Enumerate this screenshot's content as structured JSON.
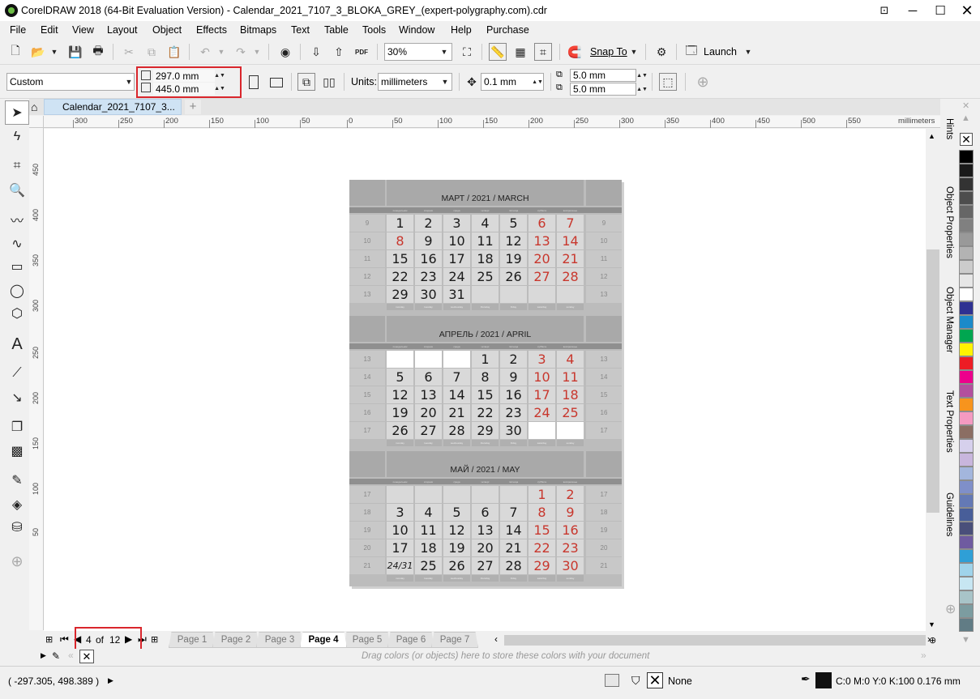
{
  "window": {
    "title": "CorelDRAW 2018 (64-Bit Evaluation Version) - Calendar_2021_7107_3_BLOKA_GREY_(expert-polygraphy.com).cdr"
  },
  "menu": [
    "File",
    "Edit",
    "View",
    "Layout",
    "Object",
    "Effects",
    "Bitmaps",
    "Text",
    "Table",
    "Tools",
    "Window",
    "Help",
    "Purchase"
  ],
  "standard_toolbar": {
    "zoom": "30%",
    "snap_to": "Snap To",
    "launch": "Launch",
    "pdf": "PDF"
  },
  "property_bar": {
    "page_preset": "Custom",
    "width": "297.0 mm",
    "height": "445.0 mm",
    "units_label": "Units:",
    "units": "millimeters",
    "nudge": "0.1 mm",
    "dup_x": "5.0 mm",
    "dup_y": "5.0 mm"
  },
  "document_tab": "Calendar_2021_7107_3...",
  "ruler_h": {
    "units": "millimeters",
    "ticks": [
      "300",
      "250",
      "200",
      "150",
      "100",
      "50",
      "0",
      "50",
      "100",
      "150",
      "200",
      "250",
      "300",
      "350",
      "400",
      "450",
      "500",
      "550"
    ]
  },
  "ruler_v": [
    "450",
    "400",
    "350",
    "300",
    "250",
    "200",
    "150",
    "100",
    "50"
  ],
  "page_nav": {
    "current": "4",
    "of": "of",
    "total": "12",
    "pages": [
      "Page 1",
      "Page 2",
      "Page 3",
      "Page 4",
      "Page 5",
      "Page 6",
      "Page 7"
    ],
    "active": "Page 4"
  },
  "palette_hint": "Drag colors (or objects) here to store these colors with your document",
  "status": {
    "coords": "( -297.305, 498.389 )",
    "fill": "None",
    "outline": "C:0 M:0 Y:0 K:100  0.176 mm"
  },
  "dockers": [
    "Hints",
    "Object Properties",
    "Object Manager",
    "Text Properties",
    "Guidelines"
  ],
  "colors": {
    "red_box": "#d9262c",
    "cal_red": "#c8372d",
    "tab_blue": "#cfe3f4"
  },
  "palette": [
    "#000000",
    "#1a1a1a",
    "#333333",
    "#4d4d4d",
    "#666666",
    "#808080",
    "#999999",
    "#b3b3b3",
    "#cccccc",
    "#e6e6e6",
    "#ffffff",
    "#2e3192",
    "#1b8ac9",
    "#00a650",
    "#fff200",
    "#ed1c24",
    "#ec008c",
    "#b34f9e",
    "#f7941d",
    "#f49ac1",
    "#8b6e63",
    "#d6d0ec",
    "#c8b6dd",
    "#a3b6dd",
    "#7f8fc9",
    "#6479b5",
    "#485e99",
    "#4a4f7a",
    "#6f5ba0",
    "#2f9fd6",
    "#9fd3ea",
    "#c7e6f2",
    "#a8c4c8",
    "#7c9ca0",
    "#617c85"
  ],
  "calendar": {
    "day_names": [
      "понедельник",
      "вторник",
      "среда",
      "четверг",
      "пятница",
      "суббота",
      "воскресенье"
    ],
    "day_names_en": [
      "monday",
      "tuesday",
      "wednesday",
      "thursday",
      "friday",
      "saturday",
      "sunday"
    ],
    "months": [
      {
        "title": "МАРТ / 2021 / MARCH",
        "weeks": [
          "9",
          "10",
          "11",
          "12",
          "13"
        ],
        "rows": [
          [
            "1",
            "2",
            "3",
            "4",
            "5",
            "6",
            "7"
          ],
          [
            "8",
            "9",
            "10",
            "11",
            "12",
            "13",
            "14"
          ],
          [
            "15",
            "16",
            "17",
            "18",
            "19",
            "20",
            "21"
          ],
          [
            "22",
            "23",
            "24",
            "25",
            "26",
            "27",
            "28"
          ],
          [
            "29",
            "30",
            "31",
            "",
            "",
            "",
            ""
          ]
        ],
        "red": [
          [
            5,
            6
          ],
          [
            0,
            5,
            6
          ],
          [
            5,
            6
          ],
          [
            5,
            6
          ],
          []
        ]
      },
      {
        "title": "АПРЕЛЬ / 2021 / APRIL",
        "weeks": [
          "13",
          "14",
          "15",
          "16",
          "17"
        ],
        "rows": [
          [
            "",
            "",
            "",
            "1",
            "2",
            "3",
            "4"
          ],
          [
            "5",
            "6",
            "7",
            "8",
            "9",
            "10",
            "11"
          ],
          [
            "12",
            "13",
            "14",
            "15",
            "16",
            "17",
            "18"
          ],
          [
            "19",
            "20",
            "21",
            "22",
            "23",
            "24",
            "25"
          ],
          [
            "26",
            "27",
            "28",
            "29",
            "30",
            "",
            ""
          ]
        ],
        "red": [
          [
            5,
            6
          ],
          [
            5,
            6
          ],
          [
            5,
            6
          ],
          [
            5,
            6
          ],
          []
        ]
      },
      {
        "title": "МАЙ / 2021 / MAY",
        "weeks": [
          "17",
          "18",
          "19",
          "20",
          "21"
        ],
        "rows": [
          [
            "",
            "",
            "",
            "",
            "",
            "1",
            "2"
          ],
          [
            "3",
            "4",
            "5",
            "6",
            "7",
            "8",
            "9"
          ],
          [
            "10",
            "11",
            "12",
            "13",
            "14",
            "15",
            "16"
          ],
          [
            "17",
            "18",
            "19",
            "20",
            "21",
            "22",
            "23"
          ],
          [
            "24/31",
            "25",
            "26",
            "27",
            "28",
            "29",
            "30"
          ]
        ],
        "red": [
          [
            5,
            6
          ],
          [
            5,
            6
          ],
          [
            5,
            6
          ],
          [
            5,
            6
          ],
          [
            5,
            6
          ]
        ]
      }
    ]
  }
}
